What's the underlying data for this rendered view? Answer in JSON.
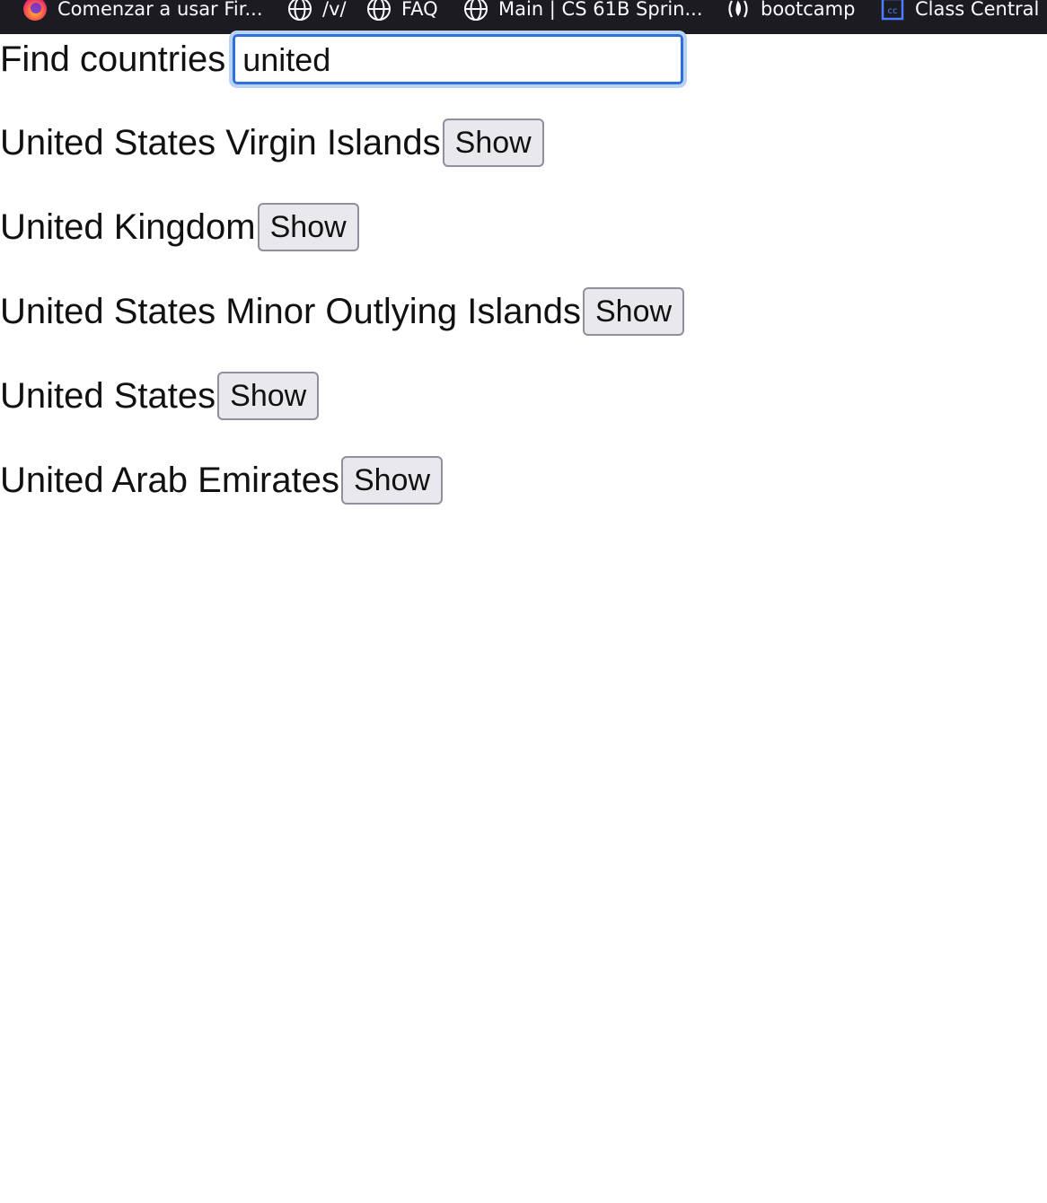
{
  "bookmarks": [
    {
      "label": "Comenzar a usar Fir...",
      "icon": "firefox-icon"
    },
    {
      "label": "/v/",
      "icon": "globe-icon"
    },
    {
      "label": "FAQ",
      "icon": "globe-icon"
    },
    {
      "label": "Main | CS 61B Sprin...",
      "icon": "globe-icon"
    },
    {
      "label": "bootcamp",
      "icon": "freecodecamp-icon"
    },
    {
      "label": "Class Central",
      "icon": "class-central-icon"
    }
  ],
  "search": {
    "label": "Find countries",
    "value": "united"
  },
  "countries": [
    {
      "name": "United States Virgin Islands",
      "button_label": "Show"
    },
    {
      "name": "United Kingdom",
      "button_label": "Show"
    },
    {
      "name": "United States Minor Outlying Islands",
      "button_label": "Show"
    },
    {
      "name": "United States",
      "button_label": "Show"
    },
    {
      "name": "United Arab Emirates",
      "button_label": "Show"
    }
  ],
  "colors": {
    "bookmarks_bg": "#1c1b22",
    "focus_border": "#2f6fd9",
    "button_bg": "#e9e9ed"
  }
}
